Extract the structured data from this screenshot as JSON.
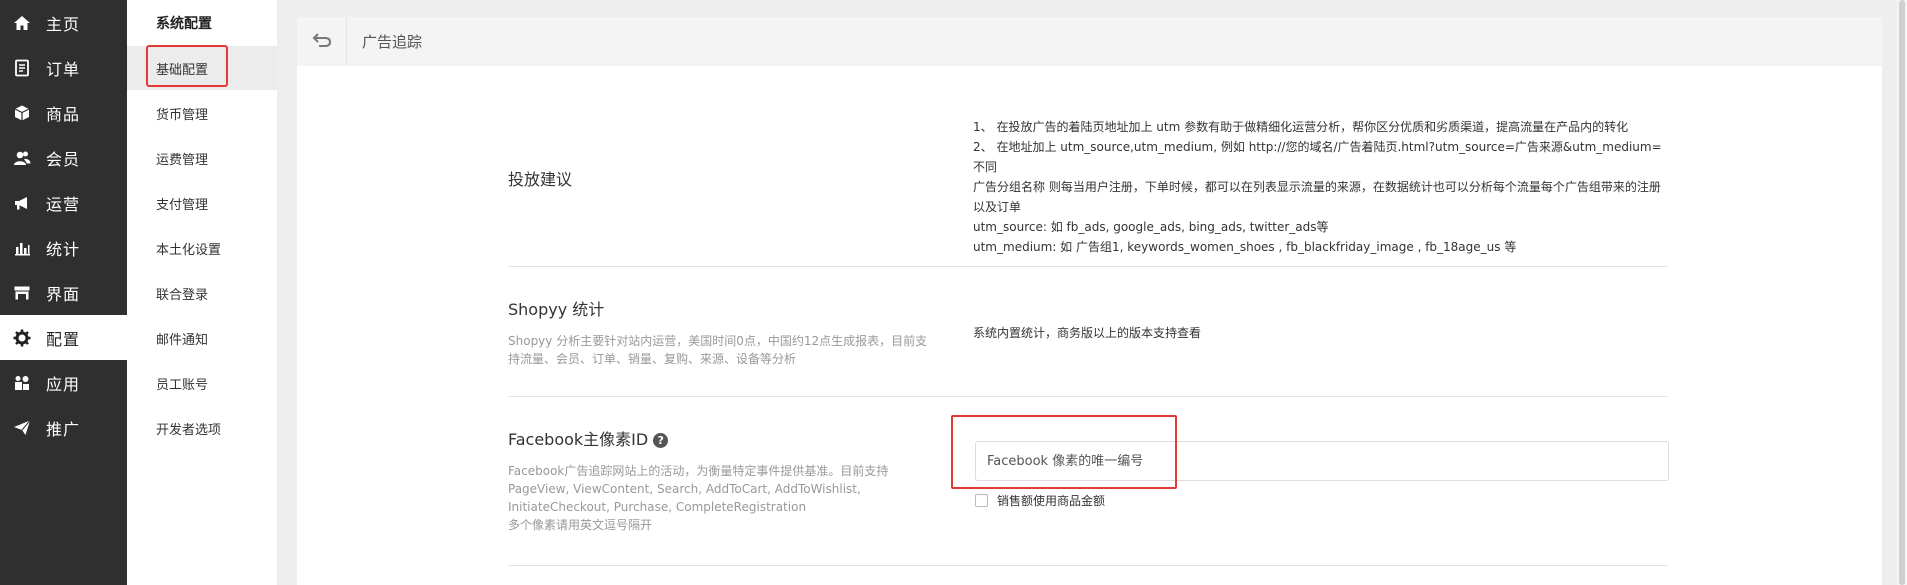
{
  "nav": {
    "items": [
      {
        "label": "主页",
        "icon": "home-icon",
        "active": false
      },
      {
        "label": "订单",
        "icon": "orders-icon",
        "active": false
      },
      {
        "label": "商品",
        "icon": "products-icon",
        "active": false
      },
      {
        "label": "会员",
        "icon": "members-icon",
        "active": false
      },
      {
        "label": "运营",
        "icon": "megaphone-icon",
        "active": false
      },
      {
        "label": "统计",
        "icon": "bar-chart-icon",
        "active": false
      },
      {
        "label": "界面",
        "icon": "storefront-icon",
        "active": false
      },
      {
        "label": "配置",
        "icon": "gear-icon",
        "active": true
      },
      {
        "label": "应用",
        "icon": "apps-icon",
        "active": false
      },
      {
        "label": "推广",
        "icon": "paper-plane-icon",
        "active": false
      }
    ]
  },
  "submenu": {
    "title": "系统配置",
    "items": [
      {
        "label": "基础配置",
        "active": true
      },
      {
        "label": "货币管理",
        "active": false
      },
      {
        "label": "运费管理",
        "active": false
      },
      {
        "label": "支付管理",
        "active": false
      },
      {
        "label": "本土化设置",
        "active": false
      },
      {
        "label": "联合登录",
        "active": false
      },
      {
        "label": "邮件通知",
        "active": false
      },
      {
        "label": "员工账号",
        "active": false
      },
      {
        "label": "开发者选项",
        "active": false
      }
    ]
  },
  "panel": {
    "title": "广告追踪",
    "back_icon": "back-arrow-icon"
  },
  "ad_advice": {
    "label": "投放建议",
    "lines": [
      "1、 在投放广告的着陆页地址加上 utm 参数有助于做精细化运营分析，帮你区分优质和劣质渠道，提高流量在产品内的转化",
      "2、 在地址加上 utm_source,utm_medium, 例如 http://您的域名/广告着陆页.html?utm_source=广告来源&utm_medium=不同",
      "广告分组名称 则每当用户注册，下单时候，都可以在列表显示流量的来源，在数据统计也可以分析每个流量每个广告组带来的注册",
      "以及订单",
      "utm_source: 如 fb_ads, google_ads, bing_ads, twitter_ads等",
      "utm_medium: 如 广告组1, keywords_women_shoes , fb_blackfriday_image , fb_18age_us 等"
    ]
  },
  "shopyy_stats": {
    "label": "Shopyy 统计",
    "desc_lines": [
      "Shopyy 分析主要针对站内运营，美国时间0点，中国约12点生成报表，目前支",
      "持流量、会员、订单、销量、复购、来源、设备等分析"
    ],
    "value": "系统内置统计，商务版以上的版本支持查看"
  },
  "facebook_pixel": {
    "label": "Facebook主像素ID",
    "help_icon": "question-circle-icon",
    "desc_lines": [
      "Facebook广告追踪网站上的活动，为衡量特定事件提供基准。目前支持",
      "PageView, ViewContent, Search, AddToCart, AddToWishlist,",
      "InitiateCheckout, Purchase, CompleteRegistration",
      "多个像素请用英文逗号隔开"
    ],
    "input_value": "",
    "input_placeholder": "Facebook 像素的唯一编号",
    "checkbox_label": "销售额使用商品金额",
    "checkbox_checked": false
  },
  "colors": {
    "nav_bg": "#2f2f2f",
    "highlight_red": "#e53935",
    "page_bg": "#eeeeee"
  }
}
